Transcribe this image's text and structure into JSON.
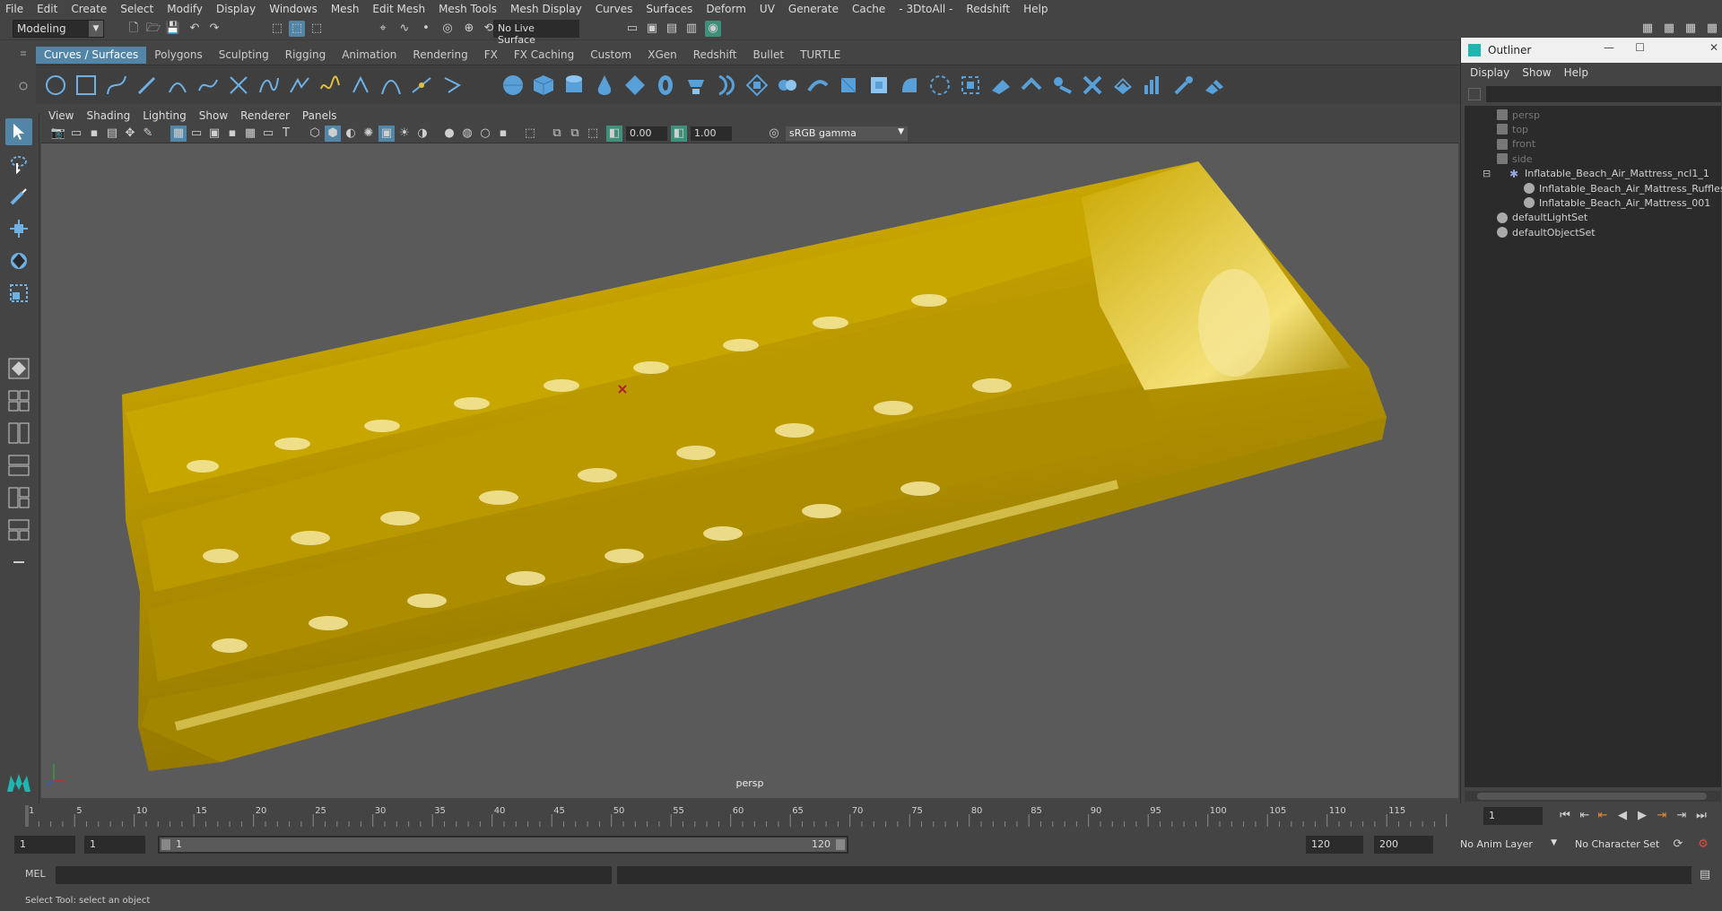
{
  "menubar": {
    "items": [
      "File",
      "Edit",
      "Create",
      "Select",
      "Modify",
      "Display",
      "Windows",
      "Mesh",
      "Edit Mesh",
      "Mesh Tools",
      "Mesh Display",
      "Curves",
      "Surfaces",
      "Deform",
      "UV",
      "Generate",
      "Cache",
      "- 3DtoAll -",
      "Redshift",
      "Help"
    ]
  },
  "statusline": {
    "mode": "Modeling",
    "live_surface": "No Live Surface"
  },
  "shelf": {
    "tabs": [
      "Curves / Surfaces",
      "Polygons",
      "Sculpting",
      "Rigging",
      "Animation",
      "Rendering",
      "FX",
      "FX Caching",
      "Custom",
      "XGen",
      "Redshift",
      "Bullet",
      "TURTLE"
    ],
    "active_tab": "Curves / Surfaces"
  },
  "panel": {
    "menu": [
      "View",
      "Shading",
      "Lighting",
      "Show",
      "Renderer",
      "Panels"
    ],
    "exposure": "0.00",
    "gamma_value": "1.00",
    "color_space": "sRGB gamma",
    "camera_label": "persp"
  },
  "outliner": {
    "title": "Outliner",
    "menu": [
      "Display",
      "Show",
      "Help"
    ],
    "items": [
      {
        "label": "persp",
        "dim": true
      },
      {
        "label": "top",
        "dim": true
      },
      {
        "label": "front",
        "dim": true
      },
      {
        "label": "side",
        "dim": true
      },
      {
        "label": "Inflatable_Beach_Air_Mattress_ncl1_1",
        "dim": false
      },
      {
        "label": "Inflatable_Beach_Air_Mattress_Ruffles",
        "dim": false
      },
      {
        "label": "Inflatable_Beach_Air_Mattress_001",
        "dim": false
      },
      {
        "label": "defaultLightSet",
        "dim": false
      },
      {
        "label": "defaultObjectSet",
        "dim": false
      }
    ]
  },
  "timeslider": {
    "ticks": [
      "1",
      "5",
      "10",
      "15",
      "20",
      "25",
      "30",
      "35",
      "40",
      "45",
      "50",
      "55",
      "60",
      "65",
      "70",
      "75",
      "80",
      "85",
      "90",
      "95",
      "100",
      "105",
      "110",
      "115"
    ],
    "current_frame": "1"
  },
  "range": {
    "start": "1",
    "playback_start": "1",
    "slider_start": "1",
    "slider_end": "120",
    "playback_end": "120",
    "end": "200",
    "anim_layer": "No Anim Layer",
    "character_set": "No Character Set"
  },
  "cmdline": {
    "label": "MEL"
  },
  "helpline": {
    "text": "Select Tool: select an object"
  },
  "colors": {
    "accent": "#5285a6",
    "mattress": "#c5a700",
    "viewport": "#5a5a5a"
  }
}
